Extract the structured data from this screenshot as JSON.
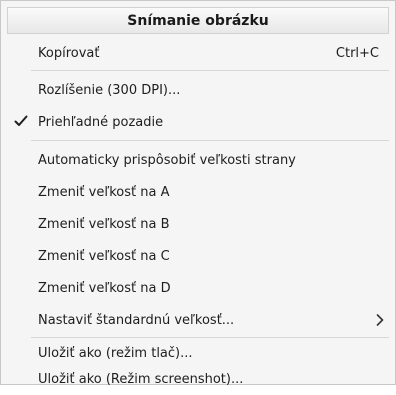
{
  "menu": {
    "title": "Snímanie obrázku",
    "items": [
      {
        "label": "Kopírovať",
        "shortcut": "Ctrl+C"
      },
      {
        "label": "Rozlíšenie (300 DPI)..."
      },
      {
        "label": "Priehľadné pozadie",
        "checked": true,
        "icon": "checkmark-icon"
      },
      {
        "label": "Automaticky prispôsobiť veľkosti strany"
      },
      {
        "label": "Zmeniť veľkosť na A"
      },
      {
        "label": "Zmeniť veľkosť na B"
      },
      {
        "label": "Zmeniť veľkosť na C"
      },
      {
        "label": "Zmeniť veľkosť na D"
      },
      {
        "label": "Nastaviť štandardnú veľkosť...",
        "submenu": true,
        "icon": "chevron-right-icon"
      },
      {
        "label": "Uložiť ako (režim tlač)..."
      },
      {
        "label": "Uložiť ako (Režim screenshot)..."
      }
    ]
  }
}
